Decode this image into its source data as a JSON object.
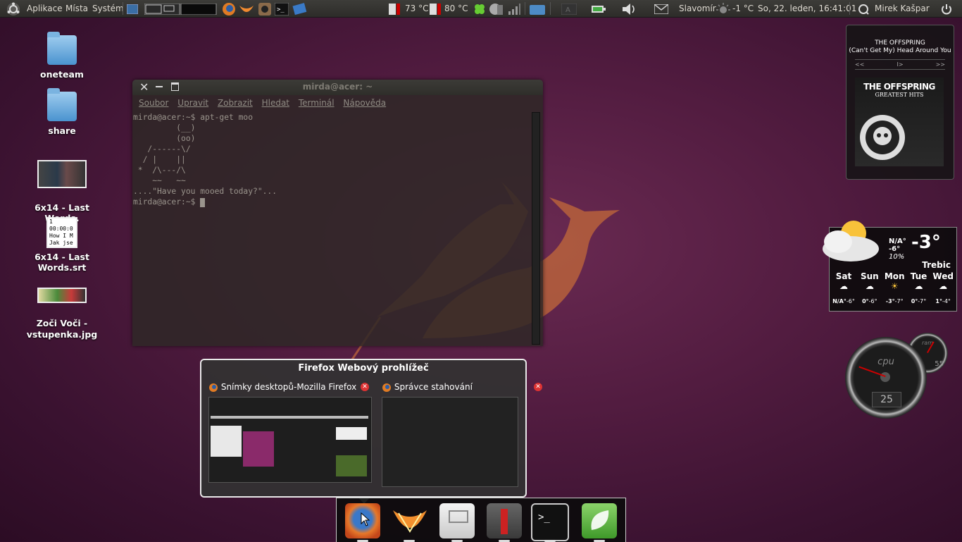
{
  "panel": {
    "menu_apps": "Aplikace",
    "menu_places": "Místa",
    "menu_system": "Systém",
    "temp1": "73 °C",
    "temp2": "80 °C",
    "location": "Slavomír",
    "weather_temp": "-1 °C",
    "datetime": "So, 22. leden, 16:41:01",
    "user": "Mirek Kašpar"
  },
  "desktop": {
    "icons": [
      {
        "label": "oneteam"
      },
      {
        "label": "share"
      },
      {
        "label": "6x14 - Last Words.\navi"
      },
      {
        "label": "6x14 - Last Words.srt"
      },
      {
        "label": "Zoči Voči -\nvstupenka.jpg"
      }
    ],
    "srt_preview": "1\n00:00:0\nHow I M\nJak jse"
  },
  "terminal": {
    "title": "mirda@acer: ~",
    "menu": [
      "Soubor",
      "Upravit",
      "Zobrazit",
      "Hledat",
      "Terminál",
      "Nápověda"
    ],
    "content": "mirda@acer:~$ apt-get moo\n         (__)\n         (oo)\n   /------\\/\n  / |    ||\n *  /\\---/\\\n    ~~   ~~\n....\"Have you mooed today?\"...\nmirda@acer:~$ "
  },
  "firefox_popup": {
    "title": "Firefox Webový prohlížeč",
    "windows": [
      {
        "label": "Snímky desktopů-Mozilla Firefox"
      },
      {
        "label": "Správce stahování"
      }
    ]
  },
  "dock": {
    "items": [
      "firefox-icon",
      "tangerine-icon",
      "file-manager-icon",
      "user-icon",
      "terminal-icon",
      "leaf-icon"
    ]
  },
  "music": {
    "artist": "THE OFFSPRING",
    "track": "(Can't Get My) Head Around You",
    "controls": [
      "<<",
      "I>",
      ">>"
    ],
    "album_title": "THE OFFSPRING",
    "album_sub": "GREATEST HITS"
  },
  "weather": {
    "na": "N/A°",
    "low": "-6°",
    "humidity": "10%",
    "current": "-3°",
    "city": "Trebic",
    "days": [
      {
        "d": "Sat",
        "hi": "N/A°",
        "lo": "-6°"
      },
      {
        "d": "Sun",
        "hi": "0°",
        "lo": "-6°"
      },
      {
        "d": "Mon",
        "hi": "-3°",
        "lo": "-7°"
      },
      {
        "d": "Tue",
        "hi": "0°",
        "lo": "-7°"
      },
      {
        "d": "Wed",
        "hi": "1°",
        "lo": "-4°"
      }
    ]
  },
  "gauges": {
    "cpu_label": "cpu",
    "cpu_value": "25",
    "ram_label": "ram",
    "ram_value": "55"
  },
  "colors": {
    "accent_orange": "#e2763a",
    "panel": "#3c3b37"
  }
}
